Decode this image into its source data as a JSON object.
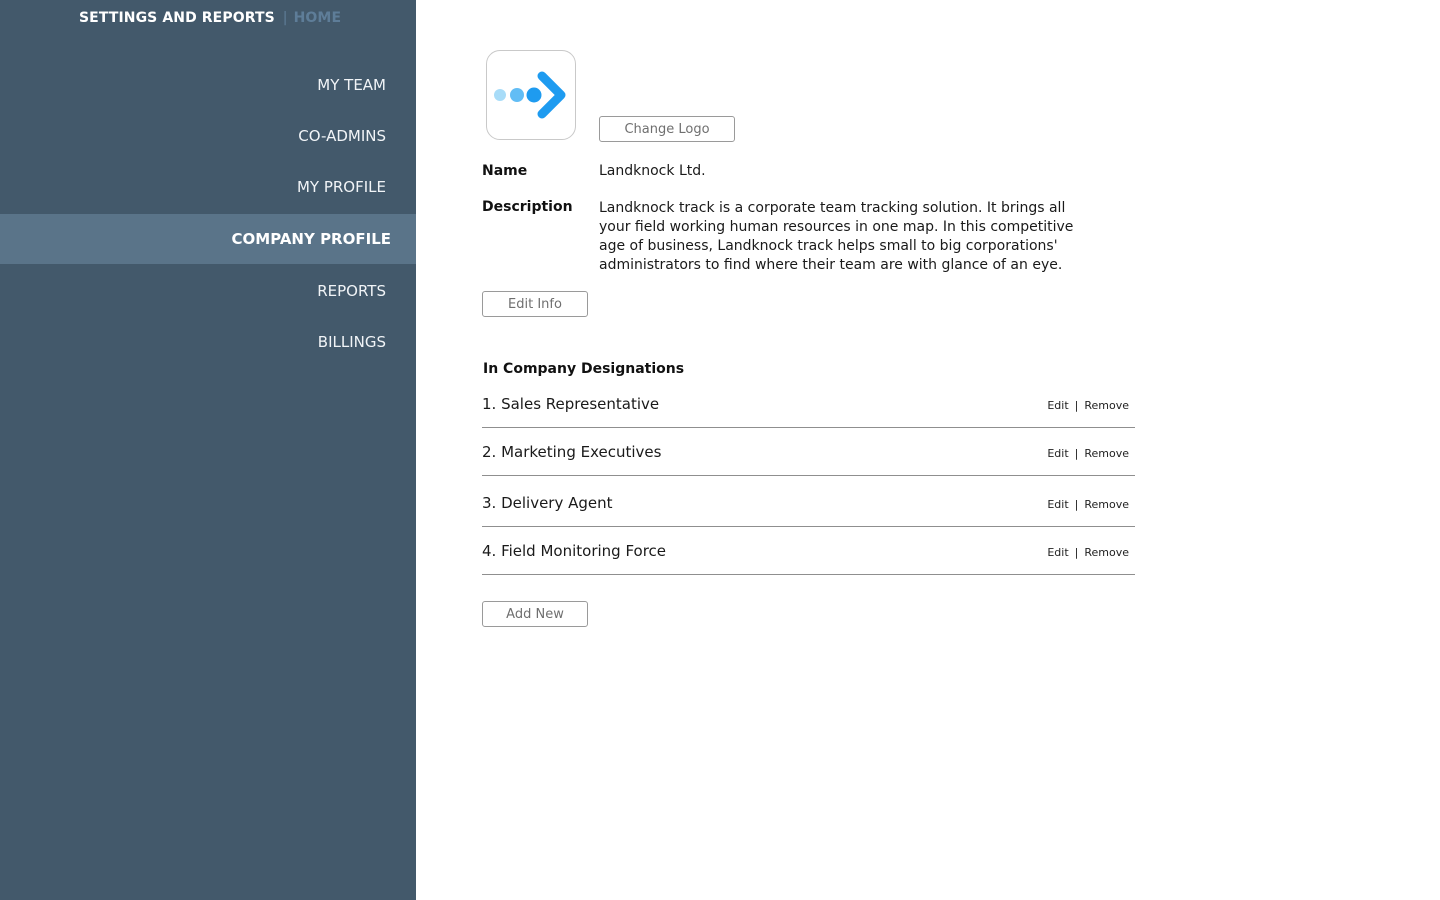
{
  "header": {
    "app_title": "SETTINGS AND REPORTS",
    "separator": "|",
    "home_label": "HOME"
  },
  "nav": {
    "items": [
      {
        "label": "MY TEAM"
      },
      {
        "label": "CO-ADMINS"
      },
      {
        "label": "MY PROFILE"
      },
      {
        "label": "COMPANY PROFILE"
      },
      {
        "label": "REPORTS"
      },
      {
        "label": "BILLINGS"
      }
    ],
    "active": "COMPANY PROFILE"
  },
  "company": {
    "logo_icon": "arrow-dots-logo-icon",
    "change_logo_label": "Change Logo",
    "name_label": "Name",
    "name_value": "Landknock Ltd.",
    "description_label": "Description",
    "description_value": "Landknock track is a corporate team tracking solution. It brings all your field working human resources in one map. In this competitive age of business, Landknock track helps small to big corporations' administrators to find where their team are with glance of an eye.",
    "edit_info_label": "Edit Info"
  },
  "designations": {
    "title": "In Company Designations",
    "items": [
      {
        "name": "1. Sales Representative",
        "edit": "Edit",
        "remove": "Remove"
      },
      {
        "name": "2. Marketing Executives",
        "edit": "Edit",
        "remove": "Remove"
      },
      {
        "name": "3. Delivery Agent",
        "edit": "Edit",
        "remove": "Remove"
      },
      {
        "name": "4. Field Monitoring Force",
        "edit": "Edit",
        "remove": "Remove"
      }
    ],
    "action_separator": "|",
    "add_new_label": "Add New"
  },
  "colors": {
    "sidebar_bg": "#43596b",
    "sidebar_active_bg": "#5a7489",
    "home_link": "#5e7d98",
    "logo_blue": "#1e9bf0",
    "logo_light_blue": "#a8dcf8"
  }
}
